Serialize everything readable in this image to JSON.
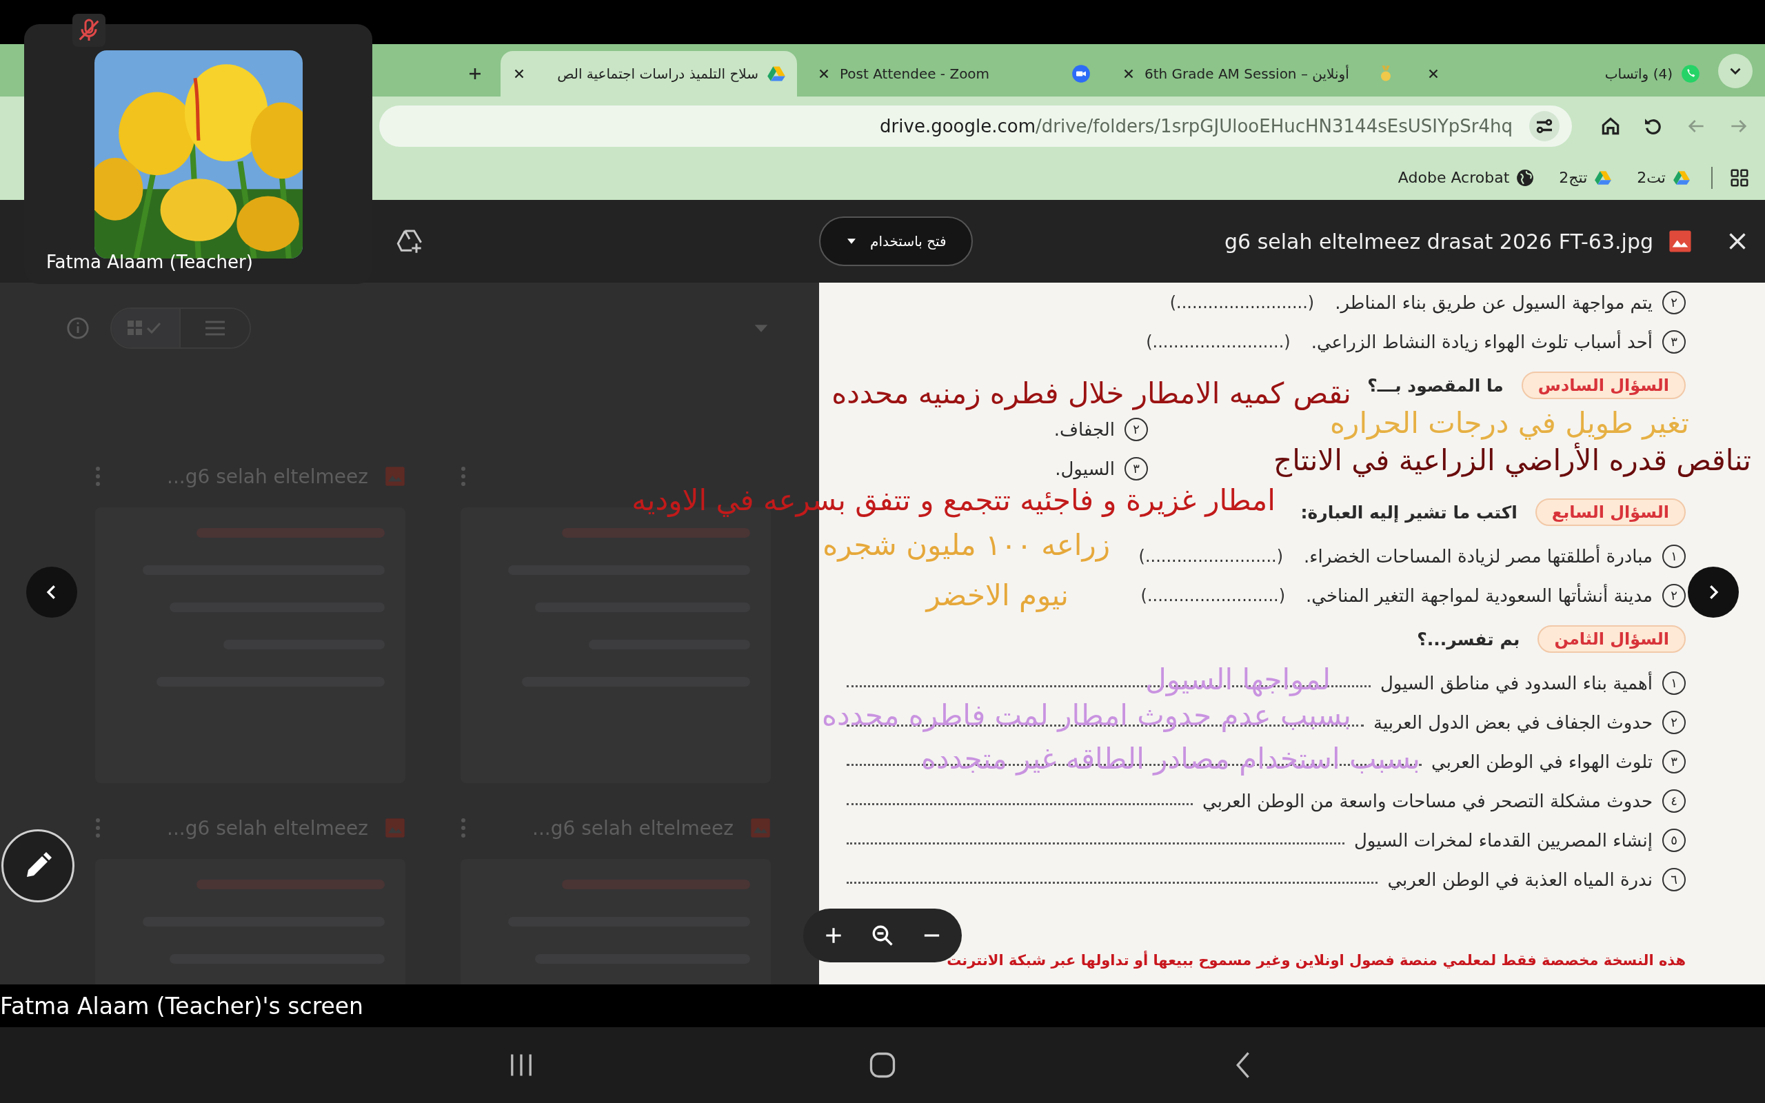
{
  "call": {
    "mic_muted": true,
    "participant": "Fatma Alaam (Teacher)",
    "caption": "Fatma Alaam (Teacher)'s screen"
  },
  "tabs": [
    {
      "title": "(4) واتساب",
      "kind": "whatsapp",
      "selected": false
    },
    {
      "title": "6th Grade AM Session – أونلاين",
      "kind": "medal",
      "selected": false
    },
    {
      "title": "Post Attendee - Zoom",
      "kind": "zoom",
      "selected": false
    },
    {
      "title": "سلاح التلميذ دراسات اجتماعية الص",
      "kind": "drive",
      "selected": true
    }
  ],
  "address_bar": {
    "host": "drive.google.com",
    "path": "/drive/folders/1srpGJUlooEHucHN3144sEsUSIYpSr4hq"
  },
  "bookmarks": [
    {
      "label": "تت2",
      "kind": "drive"
    },
    {
      "label": "تتج2",
      "kind": "drive"
    },
    {
      "label": "Adobe Acrobat",
      "kind": "globe"
    }
  ],
  "drive_files": [
    {
      "kind": "hidden"
    },
    {
      "kind": "file",
      "title": "...g6 selah eltelmeez"
    },
    {
      "kind": "file",
      "title": "...g6 selah eltelmeez"
    },
    {
      "kind": "file",
      "title": "...g6 selah eltelmeez"
    }
  ],
  "viewer": {
    "title": "g6 selah eltelmeez drasat 2026 FT-63.jpg",
    "open_with": "فتح باستخدام"
  },
  "document": {
    "rows": [
      {
        "kind": "item",
        "num": "٢",
        "text": "يتم مواجهة السيول عن طريق بناء المناطر.",
        "answer": "(.........................)"
      },
      {
        "kind": "item",
        "num": "٣",
        "text": "أحد أسباب تلوث الهواء زيادة النشاط الزراعي.",
        "answer": "(.........................)"
      },
      {
        "kind": "question",
        "badge": "السؤال السادس",
        "prompt": "ما المقصود بـــ؟"
      },
      {
        "kind": "sub",
        "num": "٢",
        "text": "الجفاف."
      },
      {
        "kind": "sub",
        "num": "٣",
        "text": "السيول."
      },
      {
        "kind": "question",
        "badge": "السؤال السابع",
        "prompt": "اكتب ما تشير إليه العبارة:"
      },
      {
        "kind": "item",
        "num": "١",
        "text": "مبادرة أطلقتها مصر لزيادة المساحات الخضراء.",
        "answer": "(.........................)"
      },
      {
        "kind": "item",
        "num": "٢",
        "text": "مدينة أنشأتها السعودية لمواجهة التغير المناخي.",
        "answer": "(.........................)"
      },
      {
        "kind": "question",
        "badge": "السؤال الثامن",
        "prompt": "بم تفسر...؟"
      },
      {
        "kind": "explain",
        "num": "١",
        "text": "أهمية بناء السدود في مناطق السيول"
      },
      {
        "kind": "explain",
        "num": "٢",
        "text": "حدوث الجفاف في بعض الدول العربية"
      },
      {
        "kind": "explain",
        "num": "٣",
        "text": "تلوث الهواء في الوطن العربي"
      },
      {
        "kind": "explain",
        "num": "٤",
        "text": "حدوث مشكلة التصحر في مساحات واسعة من الوطن العربي"
      },
      {
        "kind": "explain",
        "num": "٥",
        "text": "إنشاء المصريين القدماء لمخرات السيول"
      },
      {
        "kind": "explain",
        "num": "٦",
        "text": "ندرة المياه العذبة في الوطن العربي"
      }
    ],
    "footer": "هذه النسخة مخصصة فقط لمعلمي منصة فصول اونلاين وغير مسموح ببيعها أو تداولها عبر شبكة الانترنت"
  },
  "annotations": [
    {
      "text": "نقص كميه الامطار خلال فطره زمنيه محدده",
      "color": "#9b1212"
    },
    {
      "text": "تغير طويل في درجات الحراره",
      "color": "#e6b043"
    },
    {
      "text": "تناقص قدره الأراضي الزراعية في الانتاج",
      "color": "#6a0c0c"
    },
    {
      "text": "امطار غزيرة و فاجئيه تتجمع و تتفق بسرعه في الاوديه",
      "color": "#c21a1a"
    },
    {
      "text": "زراعه ١٠٠ مليون شجره",
      "color": "#e6a83a"
    },
    {
      "text": "نيوم الاخضر",
      "color": "#e6a83a"
    },
    {
      "text": "لمواجها السيول",
      "color": "#c993e0"
    },
    {
      "text": "بسبب عدم حدوث امطار لمت فاطره محدده",
      "color": "#c993e0"
    },
    {
      "text": "بسبب استخدام مصادر الطاقه غير متجدده",
      "color": "#c993e0"
    }
  ]
}
